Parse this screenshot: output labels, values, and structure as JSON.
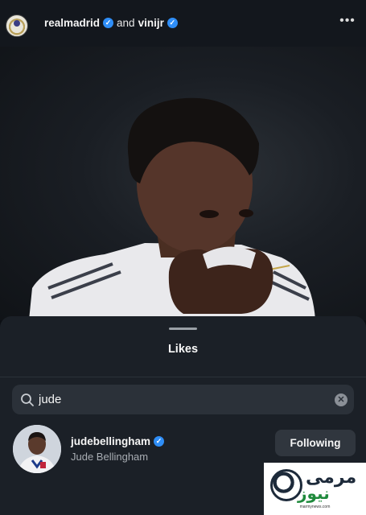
{
  "post": {
    "owner_primary": "realmadrid",
    "owner_connector": "and",
    "owner_secondary": "vinijr",
    "more_icon": "more-horizontal-icon"
  },
  "likes_sheet": {
    "title": "Likes",
    "search": {
      "value": "jude",
      "icon": "search-icon",
      "clear_icon": "clear-icon"
    },
    "results": [
      {
        "username": "judebellingham",
        "full_name": "Jude Bellingham",
        "verified": true,
        "follow_label": "Following"
      }
    ]
  },
  "watermark": {
    "line1": "مرمى",
    "line2": "نيوز",
    "tagline": "marmynews.com"
  },
  "colors": {
    "verified": "#2f8ef7",
    "sheet_bg": "#1b2027",
    "search_bg": "#2b3139",
    "button_bg": "#30363e"
  }
}
